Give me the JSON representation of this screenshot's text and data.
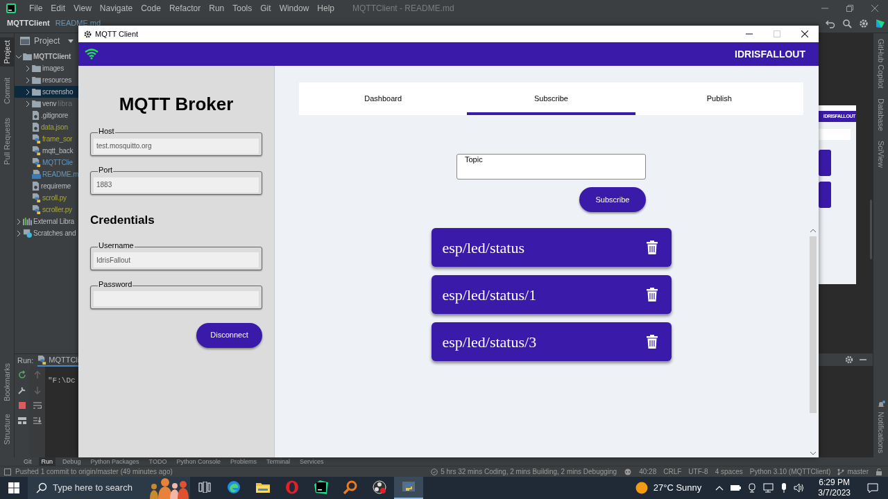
{
  "ide": {
    "menu": [
      "File",
      "Edit",
      "View",
      "Navigate",
      "Code",
      "Refactor",
      "Run",
      "Tools",
      "Git",
      "Window",
      "Help"
    ],
    "title": "MQTTClient - README.md",
    "breadcrumb": [
      "MQTTClient",
      "README.md"
    ],
    "left_tool_tabs": [
      {
        "label": "Project",
        "selected": true
      },
      {
        "label": "Commit",
        "selected": false
      },
      {
        "label": "Pull Requests",
        "selected": false
      }
    ],
    "left_bottom_tool_tabs": [
      "Bookmarks",
      "Structure"
    ],
    "project_panel": {
      "title": "Project",
      "tree": [
        {
          "label": "MQTTClient",
          "kind": "folder",
          "expanded": true,
          "selected": false,
          "modified": false,
          "unversioned": false,
          "children": [
            {
              "label": "images",
              "kind": "folder",
              "expanded": false,
              "selected": false,
              "modified": false,
              "unversioned": false
            },
            {
              "label": "resources",
              "kind": "folder",
              "expanded": false,
              "selected": false,
              "modified": false,
              "unversioned": false
            },
            {
              "label": "screensho",
              "kind": "folder",
              "expanded": false,
              "selected": true,
              "modified": false,
              "unversioned": false
            },
            {
              "label": "venv",
              "note": "libra",
              "kind": "folder",
              "expanded": false,
              "selected": false,
              "modified": false,
              "unversioned": false
            },
            {
              "label": ".gitignore",
              "kind": "file",
              "selected": false,
              "modified": false,
              "unversioned": false
            },
            {
              "label": "data.json",
              "kind": "file",
              "selected": false,
              "modified": false,
              "unversioned": true
            },
            {
              "label": "frame_sor",
              "kind": "python",
              "selected": false,
              "modified": false,
              "unversioned": true
            },
            {
              "label": "mqtt_back",
              "kind": "python",
              "selected": false,
              "modified": false,
              "unversioned": false
            },
            {
              "label": "MQTTClie",
              "kind": "python",
              "selected": false,
              "modified": true,
              "unversioned": false
            },
            {
              "label": "README.m",
              "kind": "markdown",
              "selected": false,
              "modified": true,
              "unversioned": false
            },
            {
              "label": "requireme",
              "kind": "file",
              "selected": false,
              "modified": false,
              "unversioned": false
            },
            {
              "label": "scroll.py",
              "kind": "python",
              "selected": false,
              "modified": false,
              "unversioned": true
            },
            {
              "label": "scroller.py",
              "kind": "python",
              "selected": false,
              "modified": false,
              "unversioned": true
            }
          ]
        },
        {
          "label": "External Libra",
          "kind": "library",
          "expanded": false,
          "selected": false,
          "modified": false,
          "unversioned": false
        },
        {
          "label": "Scratches and",
          "kind": "scratch",
          "expanded": false,
          "selected": false,
          "modified": false,
          "unversioned": false
        }
      ]
    },
    "run_panel": {
      "label": "Run:",
      "tab": "MQTTCli",
      "output": "\"F:\\Dc"
    },
    "tool_tabs": [
      {
        "label": "Git",
        "selected": false
      },
      {
        "label": "Run",
        "selected": true
      },
      {
        "label": "Debug",
        "selected": false
      },
      {
        "label": "Python Packages",
        "selected": false
      },
      {
        "label": "TODO",
        "selected": false
      },
      {
        "label": "Python Console",
        "selected": false
      },
      {
        "label": "Problems",
        "selected": false
      },
      {
        "label": "Terminal",
        "selected": false
      },
      {
        "label": "Services",
        "selected": false
      }
    ],
    "status_bar": {
      "message": "Pushed 1 commit to origin/master (49 minutes ago)",
      "activity": "5 hrs 32 mins Coding, 2 mins Building, 2 mins Debugging",
      "items": [
        "40:28",
        "CRLF",
        "UTF-8",
        "4 spaces",
        "Python 3.10 (MQTTClient)"
      ],
      "branch": "master"
    },
    "right_tool_tabs": [
      "GitHub Copilot",
      "Database",
      "SciView"
    ],
    "notifications": "Notifications",
    "preview": {
      "header": "IDRISFALLOUT"
    }
  },
  "app": {
    "title": "MQTT Client",
    "user": "IDRISFALLOUT",
    "connected": true,
    "broker": {
      "heading": "MQTT Broker",
      "fields": [
        {
          "label": "Host",
          "value": "test.mosquitto.org"
        },
        {
          "label": "Port",
          "value": "1883"
        }
      ],
      "credentials_heading": "Credentials",
      "credential_fields": [
        {
          "label": "Username",
          "value": "IdrisFallout"
        },
        {
          "label": "Password"
        }
      ],
      "button": "Disconnect"
    },
    "tabs": [
      {
        "label": "Dashboard",
        "selected": false
      },
      {
        "label": "Subscribe",
        "selected": true
      },
      {
        "label": "Publish",
        "selected": false
      }
    ],
    "topic_field": {
      "label": "Topic"
    },
    "subscribe_button": "Subscribe",
    "subscriptions": [
      "esp/led/status",
      "esp/led/status/1",
      "esp/led/status/3"
    ]
  },
  "taskbar": {
    "search_placeholder": "Type here to search",
    "weather": "27°C Sunny",
    "time": "6:29 PM",
    "date": "3/7/2023"
  }
}
